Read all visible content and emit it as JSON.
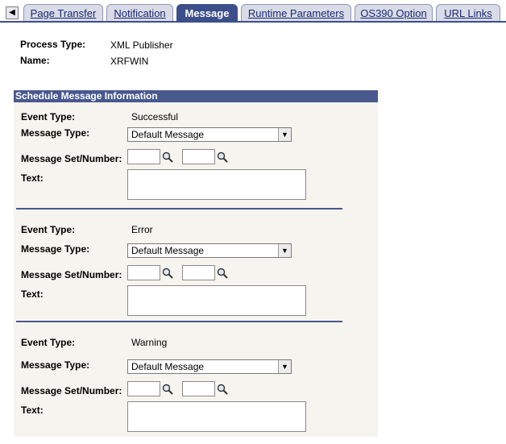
{
  "tabs": [
    {
      "label": "Page Transfer",
      "active": false
    },
    {
      "label": "Notification",
      "active": false
    },
    {
      "label": "Message",
      "active": true
    },
    {
      "label": "Runtime Parameters",
      "active": false
    },
    {
      "label": "OS390 Option",
      "active": false
    },
    {
      "label": "URL Links",
      "active": false
    }
  ],
  "header": {
    "process_type_label": "Process Type:",
    "process_type_value": "XML Publisher",
    "name_label": "Name:",
    "name_value": "XRFWIN"
  },
  "group": {
    "title": "Schedule Message Information",
    "sections": [
      {
        "event_type_label": "Event Type:",
        "event_type_value": "Successful",
        "message_type_label": "Message Type:",
        "message_type_value": "Default Message",
        "message_set_label": "Message Set/Number:",
        "text_label": "Text:"
      },
      {
        "event_type_label": "Event Type:",
        "event_type_value": "Error",
        "message_type_label": "Message Type:",
        "message_type_value": "Default Message",
        "message_set_label": "Message Set/Number:",
        "text_label": "Text:"
      },
      {
        "event_type_label": "Event Type:",
        "event_type_value": "Warning",
        "message_type_label": "Message Type:",
        "message_type_value": "Default Message",
        "message_set_label": "Message Set/Number:",
        "text_label": "Text:"
      }
    ]
  },
  "icons": {
    "tab_scroll": "left-triangle-icon",
    "lookup": "magnifier-icon",
    "dropdown": "dropdown-arrow-icon"
  }
}
